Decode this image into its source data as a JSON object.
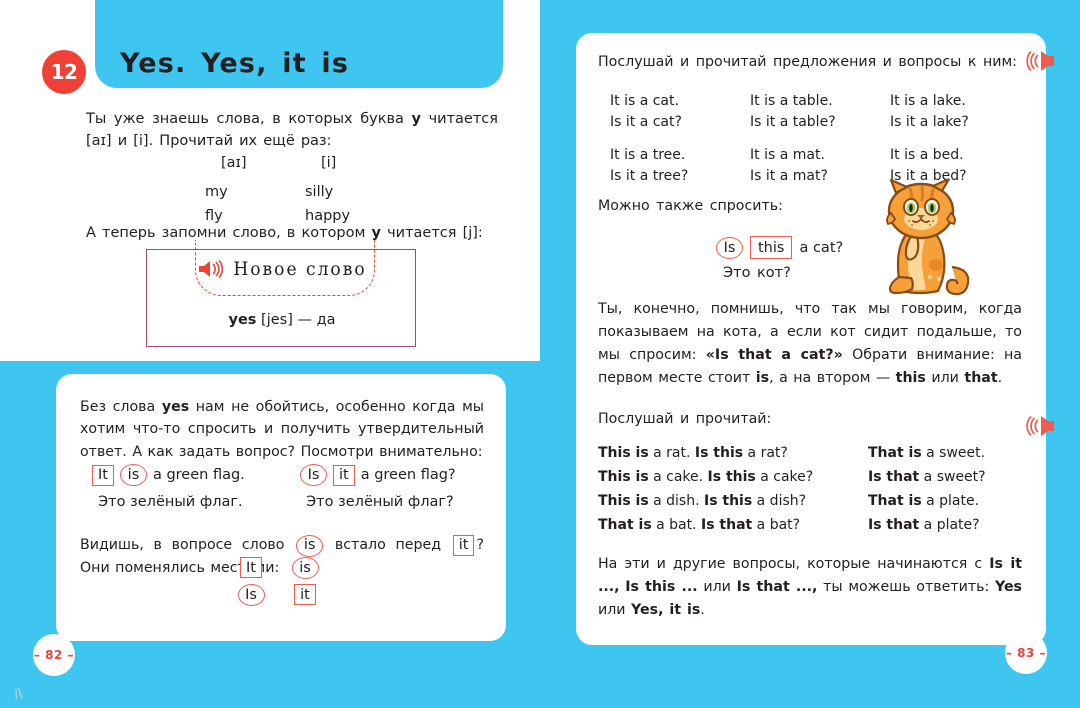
{
  "colors": {
    "cyan": "#3fc6f0",
    "red": "#ef4136",
    "marker_red": "#ef5b4e",
    "purple_border": "#a14a76",
    "ink": "#231f20"
  },
  "left_page": {
    "unit_number": "12",
    "title": "Yes. Yes, it is",
    "intro_1": "Ты уже знаешь слова, в которых буква ",
    "intro_1_bold": "y",
    "intro_1_tail": " читается [aɪ] и [i]. Прочитай их ещё раз:",
    "vocab": {
      "head_left": "[aɪ]",
      "head_right": "[i]",
      "rows": [
        {
          "left": "my",
          "right": "silly"
        },
        {
          "left": "fly",
          "right": "happy"
        }
      ]
    },
    "intro_2_head": "А теперь запомни слово, в котором ",
    "intro_2_bold": "y",
    "intro_2_tail": " читается [j]:",
    "new_word_box": {
      "banner_label": "Новое слово",
      "speaker_icon": "speaker-icon",
      "word": "yes",
      "transcription": "[jes]",
      "dash": "—",
      "translation": "да"
    },
    "card": {
      "paragraph_1_a": "Без слова ",
      "paragraph_1_bold": "yes",
      "paragraph_1_b": " нам не обойтись, особенно когда мы хотим что-то спросить и получить утвердительный ответ. А как задать вопрос? Посмотри внимательно:",
      "examples": {
        "left": {
          "box_word": "It",
          "circle_word": "is",
          "rest": "a green flag.",
          "translation": "Это зелёный флаг."
        },
        "right": {
          "circle_word": "Is",
          "box_word": "it",
          "rest": "a green flag?",
          "translation": "Это зелёный флаг?"
        }
      },
      "paragraph_2_a": "Видишь, в вопросе слово ",
      "paragraph_2_circle": "is",
      "paragraph_2_b": " встало перед ",
      "paragraph_2_box": "it",
      "paragraph_2_c": "? Они поменялись местами:",
      "swap": {
        "row1": {
          "box": "It",
          "circle": "is"
        },
        "row2": {
          "circle": "Is",
          "box": "it"
        }
      }
    },
    "page_number": "– 82 –"
  },
  "right_page": {
    "intro": "Послушай и прочитай предложения и вопросы к ним:",
    "speaker_icon_top": "speaker-icon",
    "speaker_icon_mid": "speaker-icon",
    "sentence_groups": [
      {
        "columns": [
          {
            "statement": "It is a cat.",
            "question": "Is it a cat?"
          },
          {
            "statement": "It is a table.",
            "question": "Is it a table?"
          },
          {
            "statement": "It is a lake.",
            "question": "Is it a lake?"
          }
        ]
      },
      {
        "columns": [
          {
            "statement": "It is a tree.",
            "question": "Is it a tree?"
          },
          {
            "statement": "It is a mat.",
            "question": "Is it a mat?"
          },
          {
            "statement": "It is a bed.",
            "question": "Is it a bed?"
          }
        ]
      }
    ],
    "also_ask_label": "Можно также спросить:",
    "also_ask": {
      "circle_word": "Is",
      "box_word": "this",
      "rest": "a cat?",
      "translation": "Это кот?"
    },
    "cat_illustration": "cat-illustration",
    "paragraph_a": "Ты, конечно, помнишь, что так мы говорим, когда показываем на кота, а если кот сидит подальше, то мы спросим: ",
    "paragraph_bold_1": "«Is that a cat?»",
    "paragraph_b": " Обрати внимание: на первом месте стоит ",
    "paragraph_bold_2": "is",
    "paragraph_c": ", а на втором — ",
    "paragraph_bold_3": "this",
    "paragraph_d": " или ",
    "paragraph_bold_4": "that",
    "paragraph_e": ".",
    "listen_label": "Послушай и прочитай:",
    "patterns": [
      {
        "left_bold_1": "This is",
        "left_rest_1": " a rat. ",
        "left_bold_2": "Is this",
        "left_rest_2": " a rat?",
        "right_bold": "That is",
        "right_rest": " a sweet."
      },
      {
        "left_bold_1": "This is",
        "left_rest_1": " a cake. ",
        "left_bold_2": "Is this",
        "left_rest_2": " a cake?",
        "right_bold": "Is that",
        "right_rest": " a sweet?"
      },
      {
        "left_bold_1": "This is",
        "left_rest_1": " a dish. ",
        "left_bold_2": "Is this",
        "left_rest_2": " a dish?",
        "right_bold": "That is",
        "right_rest": " a plate."
      },
      {
        "left_bold_1": "That is",
        "left_rest_1": " a bat. ",
        "left_bold_2": "Is that",
        "left_rest_2": " a bat?",
        "right_bold": "Is that",
        "right_rest": " a plate?"
      }
    ],
    "final_a": "На эти и другие вопросы, которые начинаются с ",
    "final_bold_1": "Is it ...,",
    "final_b": " ",
    "final_bold_2": "Is this ...",
    "final_c": " или ",
    "final_bold_3": "Is that ...,",
    "final_d": " ты можешь ответить: ",
    "final_bold_4": "Yes",
    "final_e": " или ",
    "final_bold_5": "Yes, it is",
    "final_f": ".",
    "page_number": "– 83 –"
  }
}
